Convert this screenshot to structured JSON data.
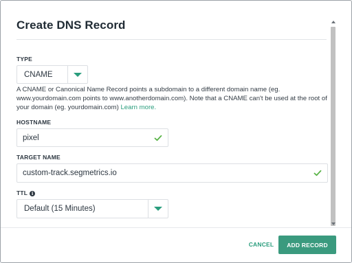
{
  "dialog": {
    "title": "Create DNS Record"
  },
  "type_field": {
    "label": "TYPE",
    "selected": "CNAME",
    "help_text": "A CNAME or Canonical Name Record points a subdomain to a different domain name (eg. www.yourdomain.com points to www.anotherdomain.com). Note that a CNAME can't be used at the root of your domain (eg. yourdomain.com)",
    "learn_more": "Learn more."
  },
  "hostname_field": {
    "label": "HOSTNAME",
    "value": "pixel",
    "valid_icon": "checkmark-icon"
  },
  "target_field": {
    "label": "TARGET NAME",
    "value": "custom-track.segmetrics.io",
    "valid_icon": "checkmark-icon"
  },
  "ttl_field": {
    "label": "TTL",
    "info_icon": "info-icon",
    "selected": "Default (15 Minutes)"
  },
  "footer": {
    "cancel_label": "CANCEL",
    "submit_label": "ADD RECORD"
  },
  "colors": {
    "accent": "#2a9d7d",
    "button": "#3a9a7e",
    "text": "#2c3640"
  }
}
